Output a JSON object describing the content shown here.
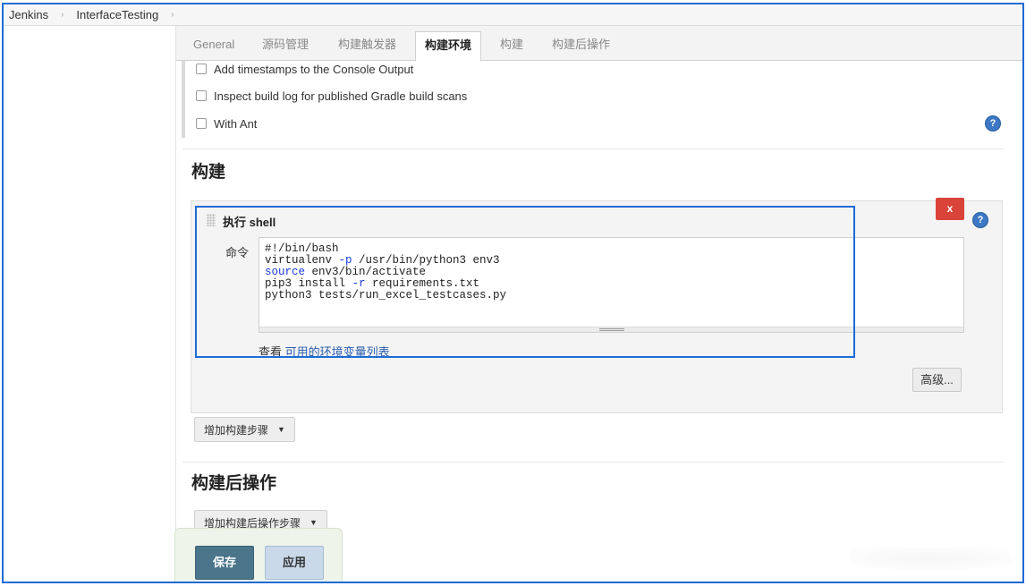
{
  "breadcrumb": {
    "items": [
      "Jenkins",
      "InterfaceTesting"
    ],
    "separator": "›"
  },
  "tabs": [
    {
      "label": "General"
    },
    {
      "label": "源码管理"
    },
    {
      "label": "构建触发器"
    },
    {
      "label": "构建环境",
      "active": true
    },
    {
      "label": "构建"
    },
    {
      "label": "构建后操作"
    }
  ],
  "build_env": {
    "options": [
      {
        "label": "Add timestamps to the Console Output",
        "checked": false
      },
      {
        "label": "Inspect build log for published Gradle build scans",
        "checked": false
      },
      {
        "label": "With Ant",
        "checked": false
      }
    ]
  },
  "icons": {
    "help": "?",
    "delete": "x",
    "caret": "▼"
  },
  "build": {
    "section_title": "构建",
    "step": {
      "title": "执行 shell",
      "command_label": "命令",
      "command_lines": [
        "#!/bin/bash",
        "virtualenv -p /usr/bin/python3 env3",
        "source env3/bin/activate",
        "pip3 install -r requirements.txt",
        "python3 tests/run_excel_testcases.py"
      ],
      "env_link_prefix": "查看 ",
      "env_link_text": "可用的环境变量列表",
      "advanced_label": "高级..."
    },
    "add_step_label": "增加构建步骤"
  },
  "post_build": {
    "section_title": "构建后操作",
    "add_step_label": "增加构建后操作步骤"
  },
  "actions": {
    "save_label": "保存",
    "apply_label": "应用"
  },
  "colors": {
    "highlight": "#1e6bd6",
    "delete": "#d9433a",
    "save": "#4b758b",
    "apply": "#c9d9ea"
  }
}
